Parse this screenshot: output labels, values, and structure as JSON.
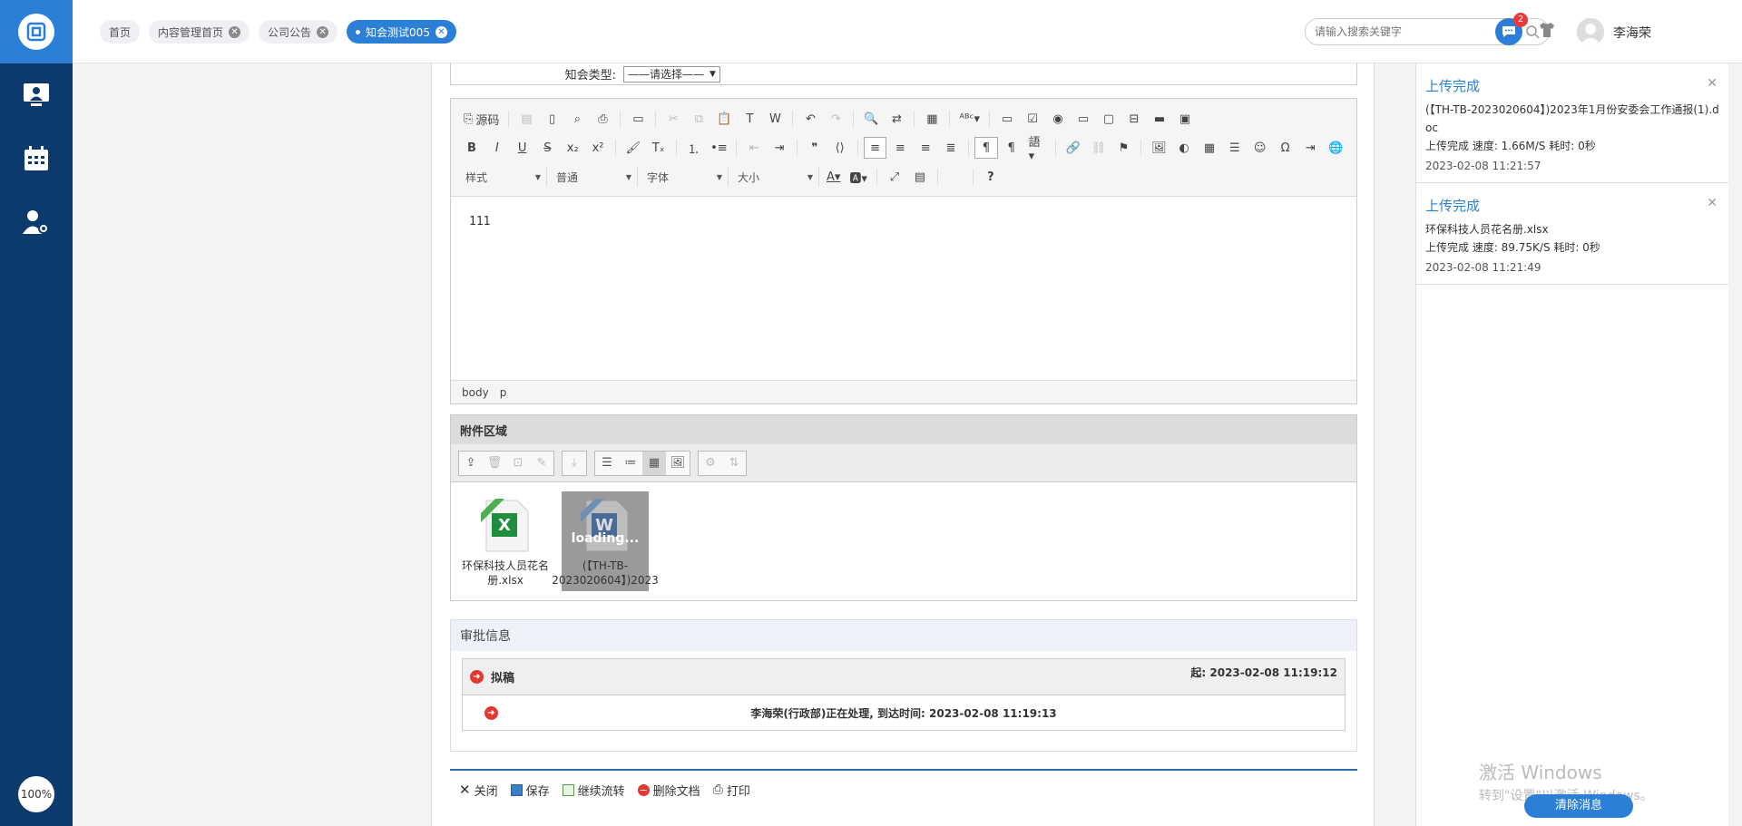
{
  "sidebar": {
    "zoom": "100%"
  },
  "header": {
    "tabs": [
      {
        "label": "首页"
      },
      {
        "label": "内容管理首页"
      },
      {
        "label": "公司公告"
      },
      {
        "label": "知会测试005"
      }
    ],
    "search_placeholder": "请输入搜索关键字",
    "message_count": "2",
    "user_name": "李海荣"
  },
  "form": {
    "type_label": "知会类型:",
    "type_value": "——请选择——"
  },
  "editor": {
    "source_label": "源码",
    "combos": [
      "样式",
      "普通",
      "字体",
      "大小"
    ],
    "content": "111",
    "path": [
      "body",
      "p"
    ]
  },
  "attachments": {
    "title": "附件区域",
    "files": [
      {
        "name": "环保科技人员花名册.xlsx",
        "type": "xlsx"
      },
      {
        "name": "(【TH-TB-2023020604】)2023",
        "type": "doc",
        "status": "loading..."
      }
    ]
  },
  "approval": {
    "title": "审批信息",
    "step_name": "拟稿",
    "start_time": "起: 2023-02-08 11:19:12",
    "status_text": "李海荣(行政部)正在处理, 到达时间: 2023-02-08 11:19:13"
  },
  "actions": [
    {
      "label": "关闭"
    },
    {
      "label": "保存"
    },
    {
      "label": "继续流转"
    },
    {
      "label": "删除文档"
    },
    {
      "label": "打印"
    }
  ],
  "notifications": [
    {
      "title": "上传完成",
      "file": "(【TH-TB-2023020604】)2023年1月份安委会工作通报(1).doc",
      "detail": "上传完成 速度: 1.66M/S 耗时: 0秒",
      "time": "2023-02-08 11:21:57"
    },
    {
      "title": "上传完成",
      "file": "环保科技人员花名册.xlsx",
      "detail": "上传完成 速度: 89.75K/S 耗时: 0秒",
      "time": "2023-02-08 11:21:49"
    }
  ],
  "watermark": {
    "line1": "激活 Windows",
    "line2": "转到\"设置\"以激活 Windows。"
  },
  "clear_button": "清除消息",
  "colors": {
    "primary": "#2b7fd6",
    "sidebar": "#0d3a6c",
    "badge": "#e83a3a"
  }
}
